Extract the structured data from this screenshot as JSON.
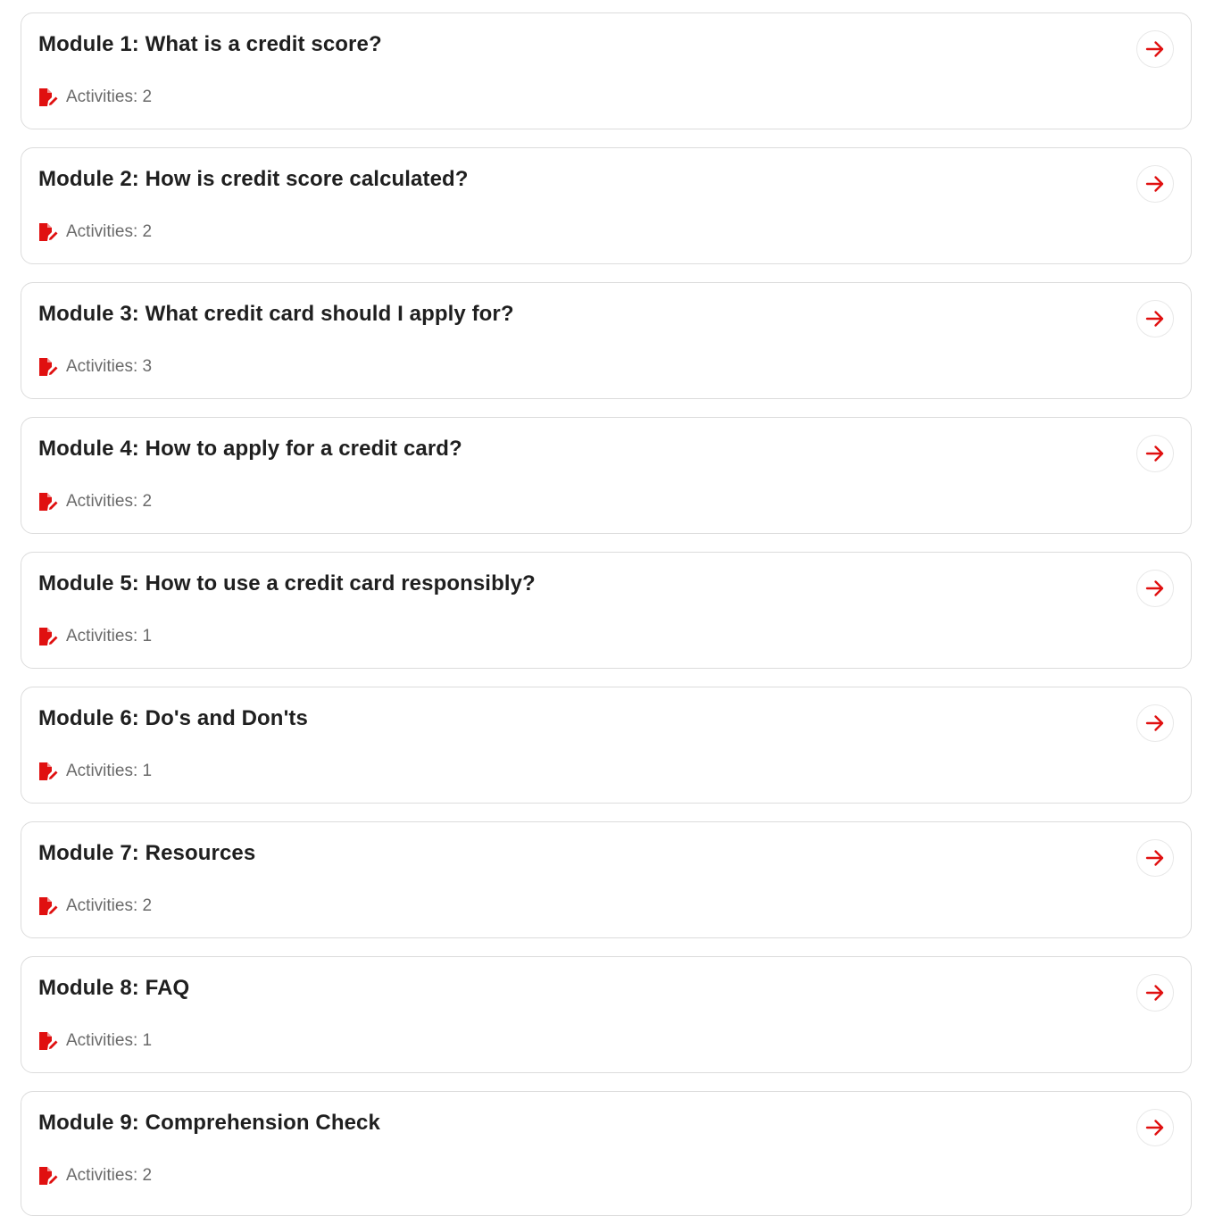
{
  "accent_color": "#e01010",
  "icons": {
    "activity": "document-edit-icon",
    "open": "arrow-right-icon"
  },
  "modules": [
    {
      "title": "Module 1: What is a credit score?",
      "activities": "Activities: 2"
    },
    {
      "title": "Module 2: How is credit score calculated?",
      "activities": "Activities: 2"
    },
    {
      "title": "Module 3: What credit card should I apply for?",
      "activities": "Activities: 3"
    },
    {
      "title": "Module 4: How to apply for a credit card?",
      "activities": "Activities: 2"
    },
    {
      "title": "Module 5: How to use a credit card responsibly?",
      "activities": "Activities: 1"
    },
    {
      "title": "Module 6: Do's and Don'ts",
      "activities": "Activities: 1"
    },
    {
      "title": "Module 7: Resources",
      "activities": "Activities: 2"
    },
    {
      "title": "Module 8: FAQ",
      "activities": "Activities: 1"
    },
    {
      "title": "Module 9: Comprehension Check",
      "activities": "Activities: 2"
    }
  ]
}
